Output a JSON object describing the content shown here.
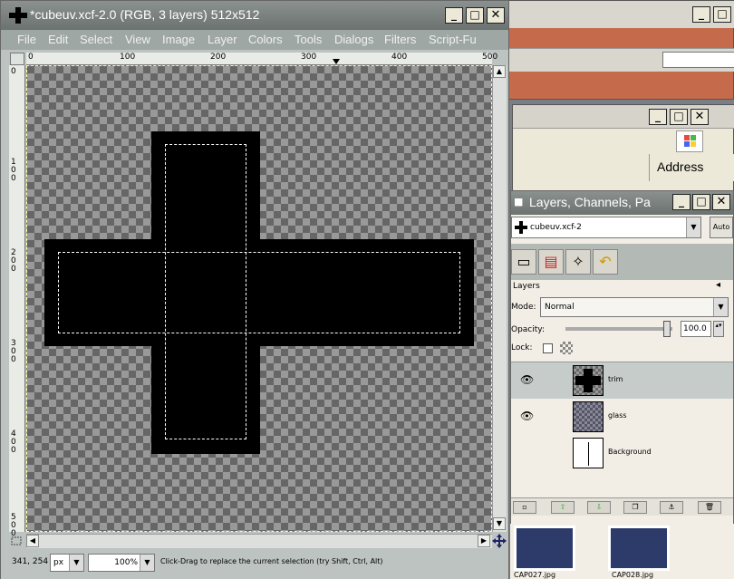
{
  "image_window": {
    "title": "*cubeuv.xcf-2.0 (RGB, 3 layers) 512x512",
    "controls": {
      "minimize": "_",
      "maximize": "□",
      "close": "✕"
    },
    "menu": [
      "File",
      "Edit",
      "Select",
      "View",
      "Image",
      "Layer",
      "Colors",
      "Tools",
      "Dialogs",
      "Filters",
      "Script-Fu"
    ],
    "hruler_labels": [
      "0",
      "100",
      "200",
      "300",
      "400",
      "500"
    ],
    "vruler_labels": [
      "0",
      "100",
      "200",
      "300",
      "400",
      "500"
    ],
    "status": {
      "coords": "341, 254",
      "unit": "px",
      "zoom": "100%",
      "message": "Click-Drag to replace the current selection (try Shift, Ctrl, Alt)"
    }
  },
  "layers_dialog": {
    "title": "Layers, Channels, Pa",
    "image_select": "cubeuv.xcf-2",
    "auto_label": "Auto",
    "section_title": "Layers",
    "mode_label": "Mode:",
    "mode_value": "Normal",
    "opacity_label": "Opacity:",
    "opacity_value": "100.0",
    "lock_label": "Lock:",
    "layers": [
      {
        "name": "trim",
        "visible": true,
        "selected": true
      },
      {
        "name": "glass",
        "visible": true,
        "selected": false
      },
      {
        "name": "Background",
        "visible": false,
        "selected": false
      }
    ]
  },
  "background": {
    "address_label": "Address",
    "thumb_captions": [
      "CAP027.jpg",
      "CAP028.jpg"
    ]
  },
  "colors": {
    "titlebar": "#6b726f",
    "selected_row": "#c6ccca"
  }
}
